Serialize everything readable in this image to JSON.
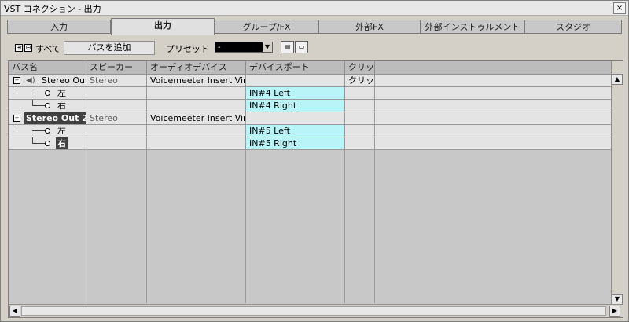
{
  "window": {
    "title": "VST コネクション - 出力",
    "close_label": "×"
  },
  "tabs": [
    {
      "label": "入力",
      "active": false
    },
    {
      "label": "出力",
      "active": true
    },
    {
      "label": "グループ/FX",
      "active": false
    },
    {
      "label": "外部FX",
      "active": false
    },
    {
      "label": "外部インストゥルメント",
      "active": false
    },
    {
      "label": "スタジオ",
      "active": false
    }
  ],
  "toolbar": {
    "expand_all_icon": "⊞",
    "collapse_all_icon": "⊟",
    "all_label": "すべて",
    "add_bus_label": "バスを追加",
    "preset_label": "プリセット",
    "preset_value": "-",
    "store_icon": "store-preset-icon",
    "remove_icon": "remove-preset-icon"
  },
  "columns": [
    "バス名",
    "スピーカー",
    "オーディオデバイス",
    "デバイスポート",
    "クリッ"
  ],
  "rows": [
    {
      "bus": "Stereo Out",
      "speaker": "Stereo",
      "device": "Voicemeeter Insert Virtua",
      "port": "",
      "click": "クリッ",
      "type": "bus"
    },
    {
      "bus": "左",
      "speaker": "",
      "device": "",
      "port": "IN#4 Left",
      "click": "",
      "type": "channel"
    },
    {
      "bus": "右",
      "speaker": "",
      "device": "",
      "port": "IN#4 Right",
      "click": "",
      "type": "channel"
    },
    {
      "bus": "Stereo Out 2",
      "speaker": "Stereo",
      "device": "Voicemeeter Insert Virtua",
      "port": "",
      "click": "",
      "type": "bus"
    },
    {
      "bus": "左",
      "speaker": "",
      "device": "",
      "port": "IN#5 Left",
      "click": "",
      "type": "channel"
    },
    {
      "bus": "右",
      "speaker": "",
      "device": "",
      "port": "IN#5 Right",
      "click": "",
      "type": "channel"
    }
  ],
  "colors": {
    "port_highlight": "#b8f4f8",
    "selected_bus": "#404040"
  }
}
